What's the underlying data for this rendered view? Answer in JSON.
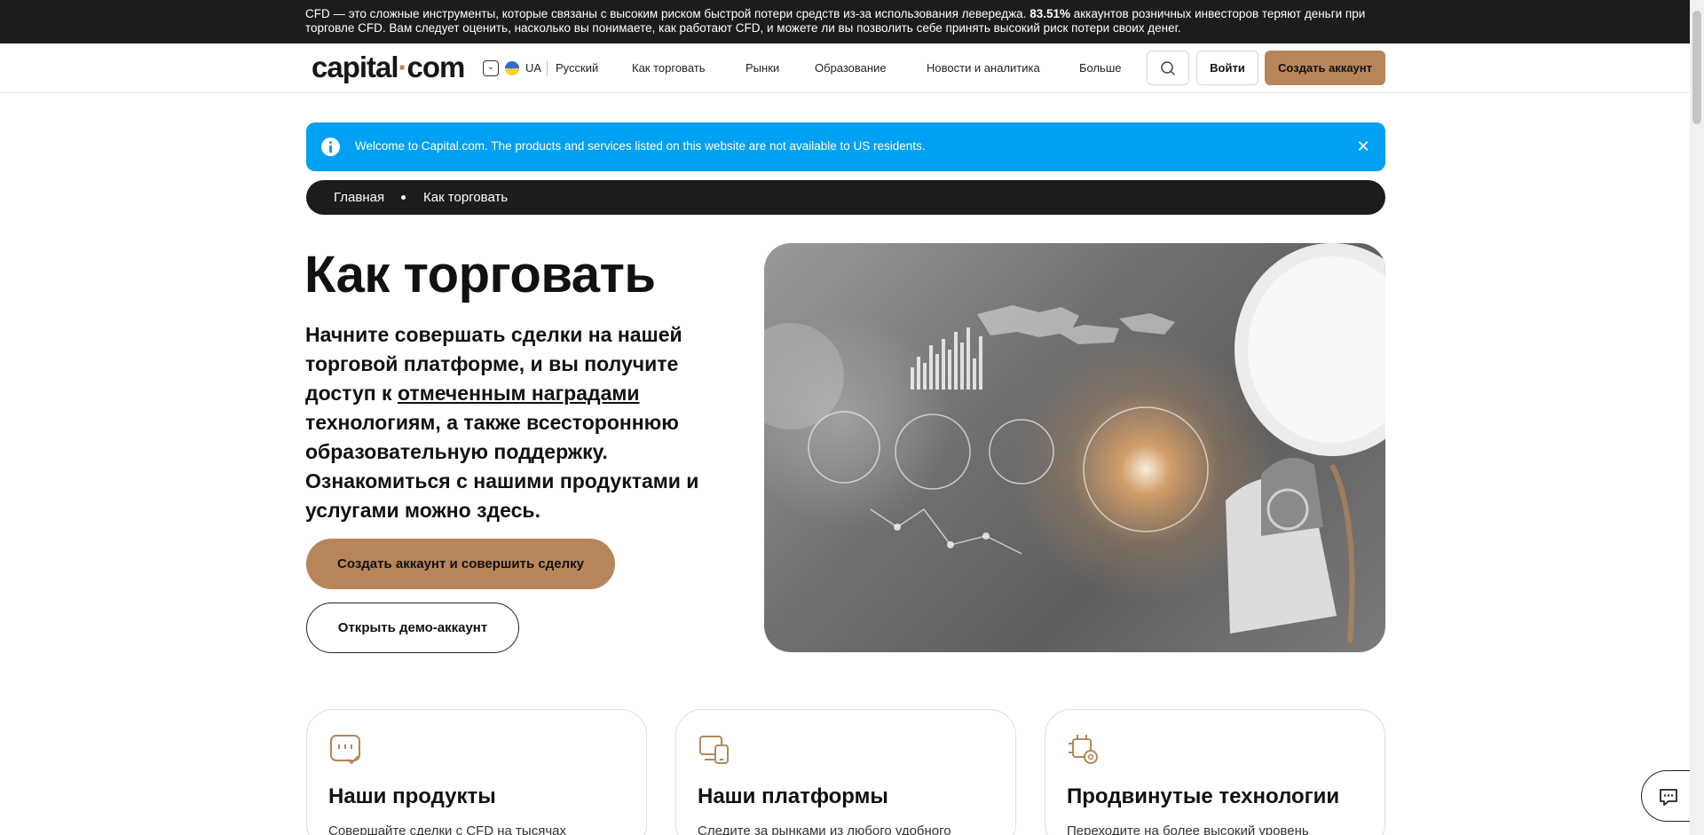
{
  "risk_warning": {
    "before": "CFD — это сложные инструменты, которые связаны с высоким риском быстрой потери средств из-за использования левереджа. ",
    "percent": "83.51%",
    "after": " аккаунтов розничных инвесторов теряют деньги при торговле CFD. Вам следует оценить, насколько вы понимаете, как работают CFD, и можете ли вы позволить себе принять высокий риск потери своих денег."
  },
  "header": {
    "logo_left": "capital",
    "logo_dot": "·",
    "logo_right": "com",
    "region_code": "UA",
    "language": "Русский",
    "nav": [
      "Как торговать",
      "Рынки",
      "Образование",
      "Новости и аналитика",
      "Больше"
    ],
    "login_label": "Войти",
    "signup_label": "Создать аккаунт",
    "icons": {
      "search": "search-icon",
      "region": "chevron-down-icon",
      "flag": "ukraine-flag-icon"
    }
  },
  "info_banner": {
    "text": "Welcome to Capital.com. The products and services listed on this website are not available to US residents.",
    "close": "✕",
    "color": "#00a0f2"
  },
  "breadcrumb": [
    "Главная",
    "Как торговать"
  ],
  "hero": {
    "title": "Как торговать",
    "intro_before": "Начните совершать сделки на нашей торговой платформе, и вы получите доступ к ",
    "intro_link": "отмеченным наградами",
    "intro_after": " технологиям, а также всестороннюю образовательную поддержку. Ознакомиться с нашими продуктами и услугами можно здесь.",
    "primary_cta": "Создать аккаунт и совершить сделку",
    "secondary_cta": "Открыть демо-аккаунт"
  },
  "features": [
    {
      "icon": "chat-check-icon",
      "title": "Наши продукты",
      "text": "Совершайте сделки с CFD на тысячах"
    },
    {
      "icon": "devices-icon",
      "title": "Наши платформы",
      "text": "Следите за рынками из любого удобного"
    },
    {
      "icon": "gear-chip-icon",
      "title": "Продвинутые технологии",
      "text": "Переходите на более высокий уровень"
    }
  ],
  "colors": {
    "accent": "#b6865a",
    "dark": "#1c1c1c",
    "info": "#00a0f2"
  }
}
